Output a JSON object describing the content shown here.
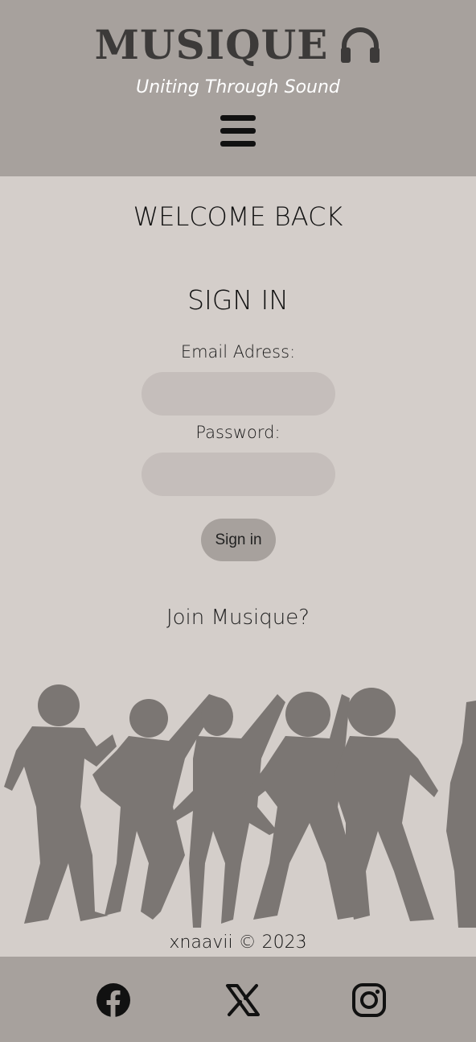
{
  "header": {
    "logo_text": "MUSIQUE",
    "logo_icon": "headphones-icon",
    "tagline": "Uniting Through Sound",
    "menu_icon": "hamburger-menu-icon"
  },
  "main": {
    "welcome_heading": "WELCOME BACK",
    "signin_heading": "SIGN IN",
    "email_label": "Email Adress:",
    "email_value": "",
    "password_label": "Password:",
    "password_value": "",
    "signin_button": "Sign in",
    "join_link": "Join Musique?"
  },
  "footer": {
    "copyright": "xnaavii © 2023",
    "social": [
      {
        "name": "Facebook",
        "icon": "facebook-icon"
      },
      {
        "name": "X",
        "icon": "x-icon"
      },
      {
        "name": "Instagram",
        "icon": "instagram-icon"
      }
    ]
  },
  "colors": {
    "header_bg": "#a7a19d",
    "page_bg": "#d4ceca",
    "input_bg": "#c5bebb",
    "silhouette": "#7b7673"
  }
}
